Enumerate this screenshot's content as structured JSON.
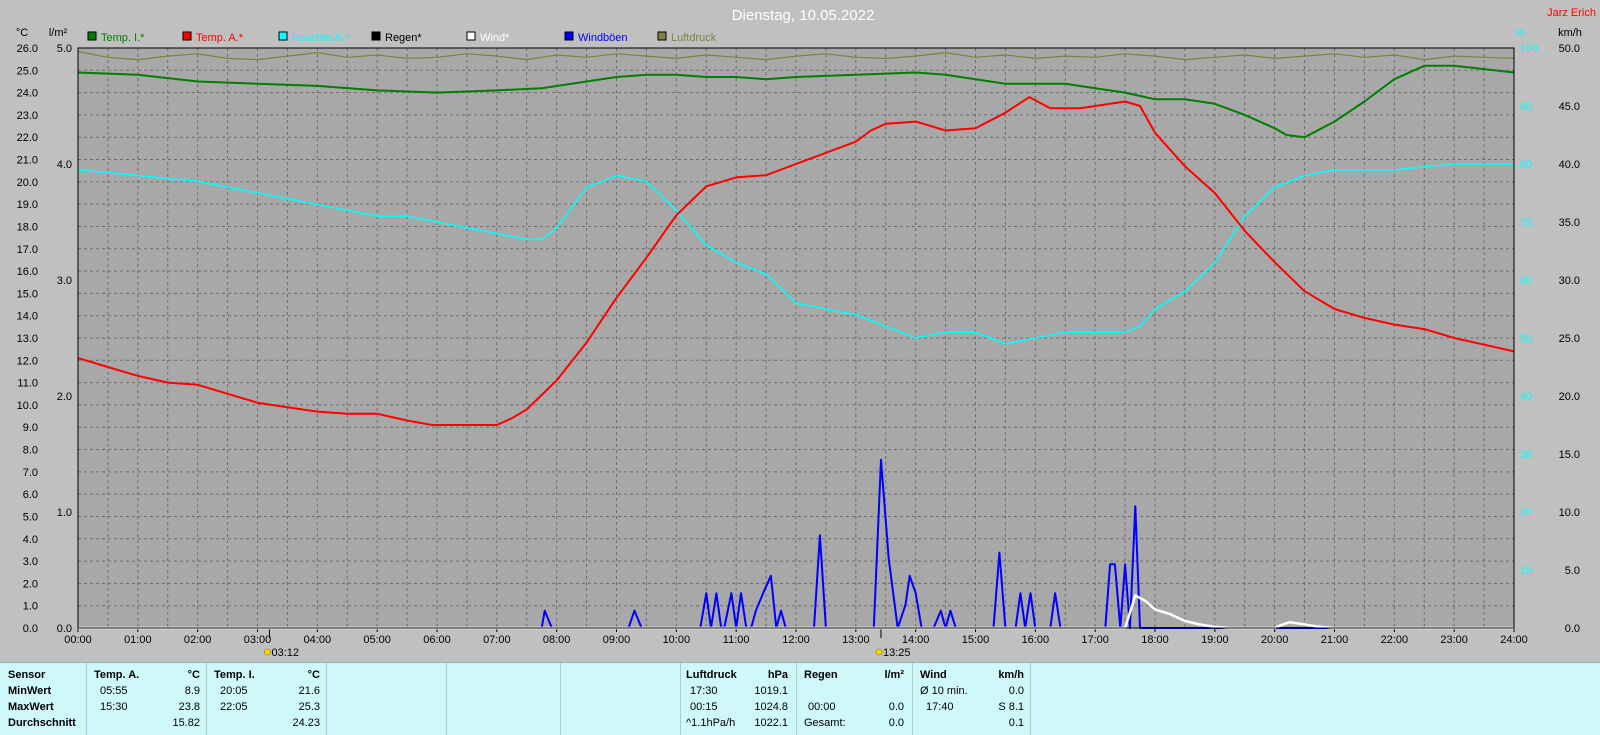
{
  "chart_data": {
    "type": "line",
    "title": "Dienstag, 10.05.2022",
    "station": "Jarz Erich",
    "legend": [
      {
        "key": "temp_i",
        "label": "Temp. I.*",
        "color": "#007f00"
      },
      {
        "key": "temp_a",
        "label": "Temp. A.*",
        "color": "#ff0000"
      },
      {
        "key": "feuchte",
        "label": "Feuchte A.*",
        "color": "#00ffff"
      },
      {
        "key": "regen",
        "label": "Regen*",
        "color": "#000000"
      },
      {
        "key": "wind",
        "label": "Wind*",
        "color": "#ffffff"
      },
      {
        "key": "boeen",
        "label": "Windböen",
        "color": "#0000ff"
      },
      {
        "key": "luftdruck",
        "label": "Luftdruck",
        "color": "#808040"
      }
    ],
    "axes": {
      "temp_unit": "°C",
      "rain_unit": "l/m²",
      "humidity_unit": "%",
      "wind_unit": "km/h",
      "temp_range": [
        0,
        26
      ],
      "rain_range": [
        0,
        5
      ],
      "humidity_range": [
        0,
        100
      ],
      "wind_range": [
        0,
        50
      ],
      "temp_ticks": [
        "26.0",
        "25.0",
        "24.0",
        "23.0",
        "22.0",
        "21.0",
        "20.0",
        "19.0",
        "18.0",
        "17.0",
        "16.0",
        "15.0",
        "14.0",
        "13.0",
        "12.0",
        "11.0",
        "10.0",
        "9.0",
        "8.0",
        "7.0",
        "6.0",
        "5.0",
        "4.0",
        "3.0",
        "2.0",
        "1.0",
        "0.0"
      ],
      "rain_ticks": [
        "5.0",
        "4.0",
        "3.0",
        "2.0",
        "1.0",
        "0.0"
      ],
      "humidity_ticks": [
        "100",
        "90",
        "80",
        "70",
        "60",
        "50",
        "40",
        "30",
        "20",
        "10"
      ],
      "wind_ticks": [
        "50.0",
        "45.0",
        "40.0",
        "35.0",
        "30.0",
        "25.0",
        "20.0",
        "15.0",
        "10.0",
        "5.0",
        "0.0"
      ],
      "x_ticks": [
        "00:00",
        "01:00",
        "02:00",
        "03:00",
        "04:00",
        "05:00",
        "06:00",
        "07:00",
        "08:00",
        "09:00",
        "10:00",
        "11:00",
        "12:00",
        "13:00",
        "14:00",
        "15:00",
        "16:00",
        "17:00",
        "18:00",
        "19:00",
        "20:00",
        "21:00",
        "22:00",
        "23:00",
        "24:00"
      ],
      "grid": true,
      "markers": [
        {
          "label": "03:12",
          "x": 3.2
        },
        {
          "label": "13:25",
          "x": 13.42
        }
      ]
    },
    "series": [
      {
        "key": "temp_i",
        "axis": "temp",
        "x": [
          0,
          1,
          2,
          3,
          4,
          5,
          6,
          7,
          7.75,
          8.5,
          9,
          9.5,
          10,
          10.5,
          11,
          11.5,
          12,
          13,
          14,
          14.5,
          15,
          15.5,
          16,
          16.5,
          17,
          17.5,
          18,
          18.5,
          19,
          19.5,
          20,
          20.2,
          20.5,
          21,
          21.5,
          22,
          22.5,
          23,
          24
        ],
        "y": [
          24.9,
          24.8,
          24.5,
          24.4,
          24.3,
          24.1,
          24,
          24.1,
          24.2,
          24.5,
          24.7,
          24.8,
          24.8,
          24.7,
          24.7,
          24.6,
          24.7,
          24.8,
          24.9,
          24.8,
          24.6,
          24.4,
          24.4,
          24.4,
          24.2,
          24,
          23.7,
          23.7,
          23.5,
          23.0,
          22.4,
          22.1,
          22.0,
          22.7,
          23.6,
          24.6,
          25.2,
          25.2,
          24.9
        ]
      },
      {
        "key": "temp_a",
        "axis": "temp",
        "x": [
          0,
          0.5,
          1,
          1.5,
          2,
          2.5,
          3,
          3.5,
          4,
          4.5,
          5,
          5.5,
          5.92,
          6.5,
          7,
          7.25,
          7.5,
          8,
          8.5,
          9,
          9.5,
          10,
          10.5,
          11,
          11.5,
          12,
          12.5,
          13,
          13.25,
          13.5,
          14,
          14.5,
          15,
          15.5,
          15.9,
          16.25,
          16.75,
          17,
          17.5,
          17.75,
          18,
          18.5,
          19,
          19.5,
          20,
          20.5,
          21,
          21.5,
          22,
          22.5,
          23,
          23.5,
          24
        ],
        "y": [
          12.1,
          11.7,
          11.3,
          11.0,
          10.9,
          10.5,
          10.1,
          9.9,
          9.7,
          9.6,
          9.6,
          9.3,
          9.1,
          9.1,
          9.1,
          9.4,
          9.8,
          11.1,
          12.8,
          14.8,
          16.6,
          18.5,
          19.8,
          20.2,
          20.3,
          20.8,
          21.3,
          21.8,
          22.3,
          22.6,
          22.7,
          22.3,
          22.4,
          23.1,
          23.8,
          23.3,
          23.3,
          23.4,
          23.6,
          23.4,
          22.2,
          20.7,
          19.5,
          17.8,
          16.4,
          15.1,
          14.3,
          13.9,
          13.6,
          13.4,
          13.0,
          12.7,
          12.4
        ]
      },
      {
        "key": "feuchte",
        "axis": "humidity",
        "x": [
          0,
          1,
          2,
          2.5,
          3,
          3.5,
          4,
          4.5,
          5,
          5.5,
          6,
          6.5,
          7,
          7.5,
          7.75,
          8,
          8.5,
          9,
          9.5,
          10,
          10.5,
          11,
          11.5,
          12,
          12.5,
          13,
          13.5,
          14,
          14.5,
          15,
          15.5,
          16,
          16.5,
          17,
          17.5,
          17.75,
          18,
          18.5,
          19,
          19.5,
          20,
          20.5,
          21,
          22,
          23,
          24
        ],
        "y": [
          79,
          78,
          77,
          76,
          75,
          74,
          73,
          72,
          71,
          71,
          70,
          69,
          68,
          67,
          67,
          69,
          76,
          78,
          77,
          72,
          66,
          63,
          61,
          56,
          55,
          54,
          52,
          50,
          51,
          51,
          49,
          50,
          51,
          51,
          51,
          52,
          55,
          58,
          63,
          71,
          76,
          78,
          79,
          79,
          80,
          80
        ]
      },
      {
        "key": "boeen",
        "axis": "wind",
        "x": [
          0,
          7.75,
          7.8,
          7.92,
          8.0,
          9.2,
          9.3,
          9.42,
          10,
          10.4,
          10.5,
          10.58,
          10.67,
          10.75,
          10.8,
          10.92,
          11,
          11.08,
          11.17,
          11.25,
          11.33,
          11.45,
          11.58,
          11.67,
          11.75,
          11.83,
          12.3,
          12.4,
          12.5,
          13.3,
          13.42,
          13.55,
          13.7,
          13.83,
          13.9,
          14.0,
          14.1,
          14.2,
          14.3,
          14.42,
          14.5,
          14.58,
          14.67,
          14.75,
          14.83,
          14.92,
          15.05,
          15.15,
          15.25,
          15.3,
          15.4,
          15.5,
          15.6,
          15.67,
          15.75,
          15.83,
          15.92,
          16.0,
          16.05,
          16.17,
          16.25,
          16.33,
          16.42,
          16.5,
          16.58,
          16.67,
          16.75,
          16.83,
          16.92,
          17.0,
          17.1,
          17.17,
          17.25,
          17.33,
          17.42,
          17.5,
          17.58,
          17.67,
          17.75,
          17.85,
          17.92,
          18.0,
          18.1,
          18.2,
          18.3,
          18.4,
          18.5,
          18.6,
          18.67,
          18.75,
          18.83,
          18.92,
          19.0,
          19.2,
          19.5,
          19.67,
          19.75,
          19.83,
          19.92,
          20.0,
          20.08,
          20.17,
          20.25,
          20.3,
          20.42,
          20.5,
          20.58,
          21,
          24
        ],
        "y": [
          0,
          0,
          1.5,
          0,
          0,
          0,
          1.5,
          0,
          0,
          0,
          3,
          0,
          3,
          0,
          0,
          3,
          0,
          3,
          0,
          0,
          1.5,
          3,
          4.5,
          0,
          1.5,
          0,
          0,
          8,
          0,
          0,
          14.5,
          6,
          0,
          2,
          4.5,
          3,
          0,
          0,
          0,
          1.5,
          0,
          1.5,
          0,
          0,
          0,
          0,
          0,
          0,
          0,
          0,
          6.5,
          0,
          0,
          0,
          3,
          0,
          3,
          0,
          0,
          0,
          0,
          3,
          0,
          0,
          0,
          0,
          0,
          0,
          0,
          0,
          0,
          0,
          5.5,
          5.5,
          0,
          5.5,
          0,
          10.5,
          0,
          0,
          0,
          0,
          0,
          0,
          0,
          0,
          0,
          0,
          0,
          0,
          0,
          0,
          0,
          0,
          0,
          0,
          0,
          0,
          0,
          0,
          0,
          0,
          0,
          0,
          0,
          0,
          0,
          0,
          0
        ]
      },
      {
        "key": "wind",
        "axis": "wind",
        "x": [
          0,
          17.5,
          17.67,
          17.85,
          18,
          18.25,
          18.5,
          18.75,
          19,
          19.25,
          20,
          20.08,
          20.25,
          20.5,
          20.75,
          21,
          24
        ],
        "y": [
          0,
          0,
          2.8,
          2.3,
          1.6,
          1.2,
          0.6,
          0.3,
          0.1,
          0,
          0,
          0.2,
          0.5,
          0.3,
          0.1,
          0,
          0
        ]
      },
      {
        "key": "luftdruck",
        "axis": "rain",
        "x": [
          0,
          0.5,
          1,
          1.5,
          2,
          2.5,
          3,
          3.5,
          4,
          4.5,
          5,
          5.5,
          6,
          6.5,
          7,
          7.5,
          8,
          8.5,
          9,
          9.5,
          10,
          10.5,
          11,
          11.5,
          12,
          12.5,
          13,
          13.5,
          14,
          14.5,
          15,
          15.5,
          16,
          16.5,
          17,
          17.5,
          18,
          18.5,
          19,
          19.5,
          20,
          20.5,
          21,
          21.5,
          22,
          22.5,
          23,
          23.5,
          24
        ],
        "y": [
          4.97,
          4.92,
          4.9,
          4.93,
          4.95,
          4.91,
          4.9,
          4.93,
          4.96,
          4.92,
          4.94,
          4.91,
          4.92,
          4.95,
          4.93,
          4.9,
          4.94,
          4.92,
          4.95,
          4.93,
          4.91,
          4.94,
          4.92,
          4.9,
          4.93,
          4.95,
          4.92,
          4.91,
          4.93,
          4.96,
          4.92,
          4.94,
          4.91,
          4.93,
          4.92,
          4.95,
          4.93,
          4.9,
          4.92,
          4.94,
          4.91,
          4.93,
          4.95,
          4.92,
          4.94,
          4.9,
          4.93,
          4.92,
          4.91
        ]
      }
    ]
  },
  "summary": {
    "sensor_header": "Sensor",
    "row_labels": [
      "MinWert",
      "MaxWert",
      "Durchschnitt"
    ],
    "temp_a": {
      "title": "Temp. A.",
      "unit": "°C",
      "times": [
        "05:55",
        "15:30",
        ""
      ],
      "values": [
        "8.9",
        "23.8",
        "15.82"
      ]
    },
    "temp_i": {
      "title": "Temp. I.",
      "unit": "°C",
      "times": [
        "20:05",
        "22:05",
        ""
      ],
      "values": [
        "21.6",
        "25.3",
        "24.23"
      ]
    },
    "luftdruck": {
      "title": "Luftdruck",
      "unit": "hPa",
      "times": [
        "17:30",
        "00:15",
        "^1.1hPa/h"
      ],
      "values": [
        "1019.1",
        "1024.8",
        "1022.1"
      ]
    },
    "regen": {
      "title": "Regen",
      "unit": "l/m²",
      "times": [
        "",
        "00:00",
        "Gesamt:"
      ],
      "values": [
        "",
        "0.0",
        "0.0"
      ]
    },
    "wind": {
      "title": "Wind",
      "unit": "km/h",
      "times": [
        "Ø 10 min.",
        "17:40",
        ""
      ],
      "values": [
        "0.0",
        "S 8.1",
        "0.1"
      ]
    }
  }
}
